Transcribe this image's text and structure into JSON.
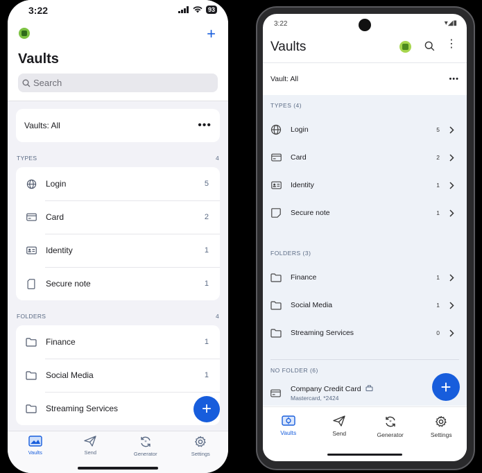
{
  "ios": {
    "status": {
      "time": "3:22",
      "battery": "93"
    },
    "header": {
      "title": "Vaults",
      "add_icon": "plus-icon"
    },
    "search": {
      "placeholder": "Search"
    },
    "vault_filter": {
      "label": "Vaults: All",
      "more": "•••"
    },
    "types": {
      "heading": "TYPES",
      "count": "4",
      "items": [
        {
          "label": "Login",
          "count": "5",
          "icon": "globe-icon"
        },
        {
          "label": "Card",
          "count": "2",
          "icon": "card-icon"
        },
        {
          "label": "Identity",
          "count": "1",
          "icon": "id-card-icon"
        },
        {
          "label": "Secure note",
          "count": "1",
          "icon": "note-icon"
        }
      ]
    },
    "folders": {
      "heading": "FOLDERS",
      "count": "4",
      "items": [
        {
          "label": "Finance",
          "count": "1",
          "icon": "folder-icon"
        },
        {
          "label": "Social Media",
          "count": "1",
          "icon": "folder-icon"
        },
        {
          "label": "Streaming Services",
          "count": "",
          "icon": "folder-icon"
        }
      ]
    },
    "fab": "+",
    "tabs": [
      {
        "label": "Vaults",
        "icon": "vault-icon",
        "active": true
      },
      {
        "label": "Send",
        "icon": "send-icon",
        "active": false
      },
      {
        "label": "Generator",
        "icon": "generator-icon",
        "active": false
      },
      {
        "label": "Settings",
        "icon": "gear-icon",
        "active": false
      }
    ]
  },
  "android": {
    "status": {
      "time": "3:22"
    },
    "appbar": {
      "title": "Vaults"
    },
    "vault_filter": {
      "label": "Vault: All",
      "more": "•••"
    },
    "types": {
      "heading": "TYPES (4)",
      "items": [
        {
          "label": "Login",
          "count": "5",
          "icon": "globe-icon"
        },
        {
          "label": "Card",
          "count": "2",
          "icon": "card-icon"
        },
        {
          "label": "Identity",
          "count": "1",
          "icon": "id-card-icon"
        },
        {
          "label": "Secure note",
          "count": "1",
          "icon": "note-icon"
        }
      ]
    },
    "folders": {
      "heading": "FOLDERS (3)",
      "items": [
        {
          "label": "Finance",
          "count": "1",
          "icon": "folder-icon"
        },
        {
          "label": "Social Media",
          "count": "1",
          "icon": "folder-icon"
        },
        {
          "label": "Streaming Services",
          "count": "0",
          "icon": "folder-icon"
        }
      ]
    },
    "no_folder": {
      "heading": "NO FOLDER (6)",
      "first_item": {
        "title": "Company Credit Card",
        "subtitle": "Mastercard, *2424"
      }
    },
    "fab": "+",
    "tabs": [
      {
        "label": "Vaults",
        "icon": "vault-icon",
        "active": true
      },
      {
        "label": "Send",
        "icon": "send-icon",
        "active": false
      },
      {
        "label": "Generator",
        "icon": "generator-icon",
        "active": false
      },
      {
        "label": "Settings",
        "icon": "gear-icon",
        "active": false
      }
    ]
  },
  "colors": {
    "accent": "#175ddc",
    "background_ios": "#f2f2f7",
    "background_android_list": "#eef2f8",
    "muted_text": "#5a6a84"
  }
}
